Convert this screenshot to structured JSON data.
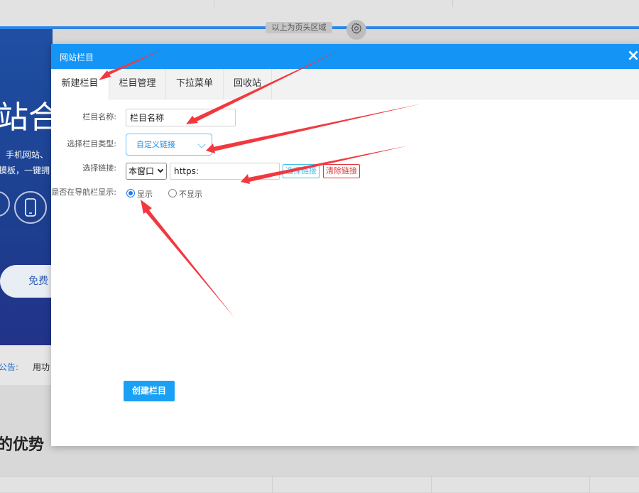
{
  "background": {
    "header_tag": "以上为页头区域",
    "hero_title": "站合",
    "hero_sub1": "手机网站、",
    "hero_sub2": "摸板，一键拥",
    "hero_button": "免费",
    "notice_label": "公告:",
    "notice_text": "用功",
    "advantage_title": "的优势"
  },
  "modal": {
    "title": "网站栏目",
    "close": "×",
    "tabs": [
      {
        "label": "新建栏目",
        "active": true
      },
      {
        "label": "栏目管理",
        "active": false
      },
      {
        "label": "下拉菜单",
        "active": false
      },
      {
        "label": "回收站",
        "active": false
      }
    ],
    "form": {
      "name_label": "栏目名称:",
      "name_value": "栏目名称",
      "type_label": "选择栏目类型:",
      "type_value": "自定义链接",
      "link_label": "选择链接:",
      "window_value": "本窗口",
      "link_value": "https:",
      "select_link_btn": "选择链接",
      "clear_link_btn": "清除链接",
      "nav_label": "是否在导航栏显示:",
      "show_label": "显示",
      "hide_label": "不显示",
      "show_selected": true
    },
    "create_button": "创建栏目"
  },
  "colors": {
    "modal_header": "#1494f5",
    "annotation_arrow": "#f2383f",
    "create_button": "#1aa1f5",
    "clear_link": "#e0353a",
    "select_link": "#3cc0ea"
  },
  "icons": {
    "gear": "gear-icon",
    "phone": "phone-icon",
    "close": "close-icon",
    "dropdown": "chevron-down-icon"
  }
}
